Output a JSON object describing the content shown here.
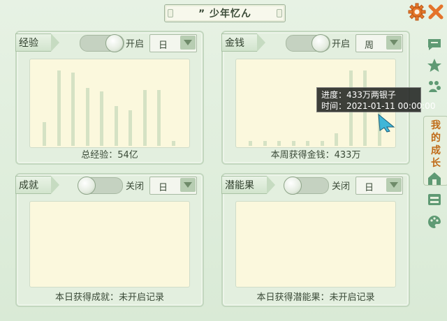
{
  "window": {
    "title": "” 少年忆ん"
  },
  "icons": {
    "settings": "gear-icon",
    "close": "close-icon"
  },
  "panels": [
    {
      "tag": "经验",
      "state_label": "开启",
      "toggle_on": true,
      "period": "日",
      "caption": "总经验：54亿",
      "bars": [
        0.3,
        0.95,
        0.92,
        0.73,
        0.68,
        0.5,
        0.45,
        0.7,
        0.7,
        0.06
      ]
    },
    {
      "tag": "金钱",
      "state_label": "开启",
      "toggle_on": true,
      "period": "周",
      "caption": "本周获得金钱：433万",
      "bars": [
        0.06,
        0.06,
        0.06,
        0.06,
        0.06,
        0.06,
        0.16,
        0.95,
        0.95,
        0.7
      ]
    },
    {
      "tag": "成就",
      "state_label": "关闭",
      "toggle_on": false,
      "period": "日",
      "caption": "本日获得成就：未开启记录",
      "bars": []
    },
    {
      "tag": "潜能果",
      "state_label": "关闭",
      "toggle_on": false,
      "period": "日",
      "caption": "本日获得潜能果：未开启记录",
      "bars": []
    }
  ],
  "sidebar": {
    "active_label": [
      "我",
      "的",
      "成",
      "长"
    ]
  },
  "tooltip": {
    "line1": "进度：433万两银子",
    "line2": "时间：2021-01-11 00:00:00"
  }
}
